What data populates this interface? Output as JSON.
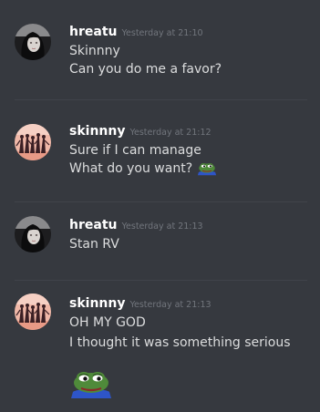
{
  "messages": [
    {
      "username": "hreatu",
      "timestamp": "Yesterday at 21:10",
      "avatar": "hreatu-avatar",
      "lines": [
        "Skinnny",
        "Can you do me a favor?"
      ]
    },
    {
      "username": "skinnny",
      "timestamp": "Yesterday at 21:12",
      "avatar": "skinnny-avatar",
      "lines": [
        "Sure if I can manage",
        "What do you want?"
      ],
      "inline_emoji": "pepe-frog-emoji"
    },
    {
      "username": "hreatu",
      "timestamp": "Yesterday at 21:13",
      "avatar": "hreatu-avatar",
      "lines": [
        "Stan RV"
      ]
    },
    {
      "username": "skinnny",
      "timestamp": "Yesterday at 21:13",
      "avatar": "skinnny-avatar",
      "lines": [
        "OH MY GOD",
        "I thought it was something serious"
      ],
      "large_emoji": "pepe-frog-emoji"
    }
  ],
  "colors": {
    "background": "#36393f",
    "username": "#ffffff",
    "timestamp": "#72767d",
    "text": "#dcddde",
    "divider": "#40434a"
  }
}
